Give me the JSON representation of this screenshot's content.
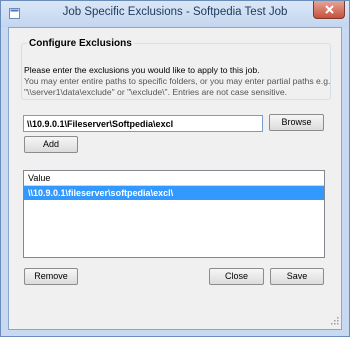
{
  "window": {
    "title": "Job Specific Exclusions - Softpedia Test Job"
  },
  "group": {
    "title": "Configure Exclusions"
  },
  "description": {
    "line1": "Please enter the exclusions you would like to apply to this job.",
    "line2": "You may enter entire paths to specific folders, or you may enter partial paths e.g.",
    "line3": "\"\\\\server1\\data\\exclude\" or \"\\exclude\\\". Entries are not case sensitive."
  },
  "path_input": {
    "value": "\\\\10.9.0.1\\Fileserver\\Softpedia\\excl"
  },
  "buttons": {
    "browse": "Browse",
    "add": "Add",
    "remove": "Remove",
    "close": "Close",
    "save": "Save"
  },
  "exclusions_list": {
    "column_header": "Value",
    "rows": [
      "\\\\10.9.0.1\\fileserver\\softpedia\\excl\\"
    ]
  },
  "colors": {
    "selection": "#3399ff",
    "close_button": "#c9503d"
  }
}
